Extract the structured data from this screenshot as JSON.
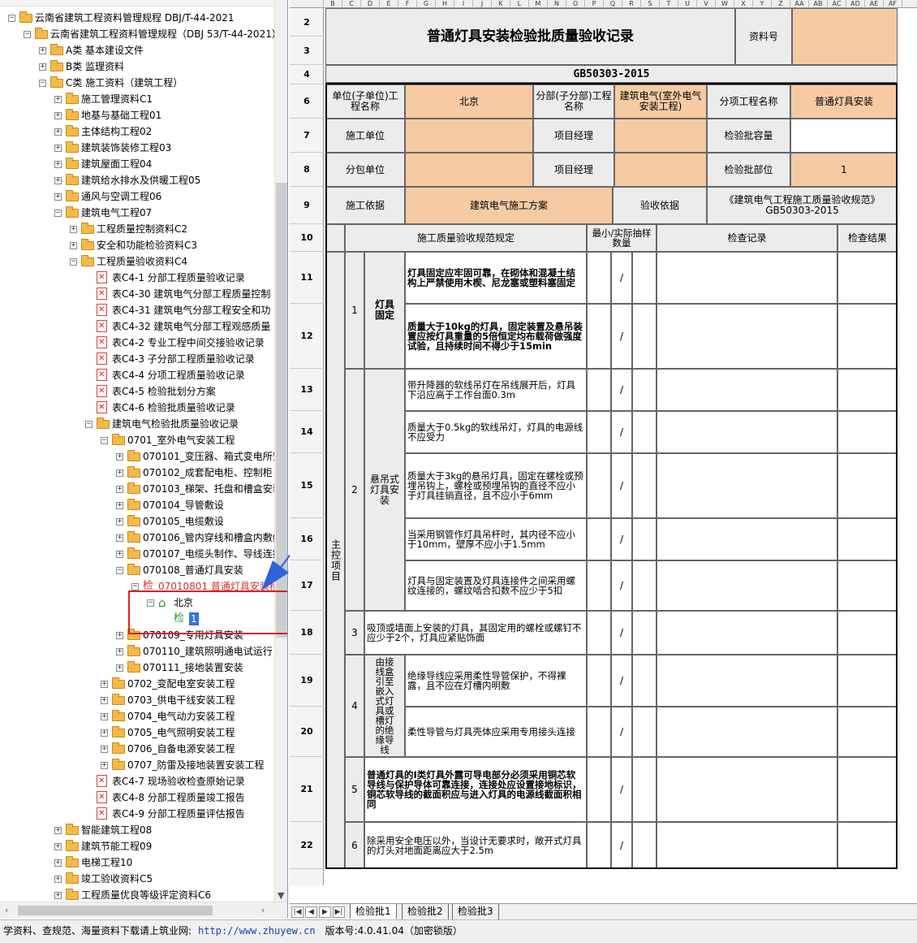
{
  "tree": {
    "items": [
      {
        "level": 0,
        "expand": "-",
        "icon": "folder",
        "label": "云南省建筑工程资料管理规程 DBJ/T-44-2021"
      },
      {
        "level": 1,
        "expand": "-",
        "icon": "folder",
        "label": "云南省建筑工程资料管理规程（DBJ 53/T-44-2021）"
      },
      {
        "level": 2,
        "expand": "+",
        "icon": "folder",
        "label": "A类 基本建设文件"
      },
      {
        "level": 2,
        "expand": "+",
        "icon": "folder",
        "label": "B类 监理资料"
      },
      {
        "level": 2,
        "expand": "-",
        "icon": "folder",
        "label": "C类 施工资料（建筑工程）"
      },
      {
        "level": 3,
        "expand": "+",
        "icon": "folder",
        "label": "施工管理资料C1"
      },
      {
        "level": 3,
        "expand": "+",
        "icon": "folder",
        "label": "地基与基础工程01"
      },
      {
        "level": 3,
        "expand": "+",
        "icon": "folder",
        "label": "主体结构工程02"
      },
      {
        "level": 3,
        "expand": "+",
        "icon": "folder",
        "label": "建筑装饰装修工程03"
      },
      {
        "level": 3,
        "expand": "+",
        "icon": "folder",
        "label": "建筑屋面工程04"
      },
      {
        "level": 3,
        "expand": "+",
        "icon": "folder",
        "label": "建筑给水排水及供暖工程05"
      },
      {
        "level": 3,
        "expand": "+",
        "icon": "folder",
        "label": "通风与空调工程06"
      },
      {
        "level": 3,
        "expand": "-",
        "icon": "folder",
        "label": "建筑电气工程07"
      },
      {
        "level": 4,
        "expand": "+",
        "icon": "folder",
        "label": "工程质量控制资料C2"
      },
      {
        "level": 4,
        "expand": "+",
        "icon": "folder",
        "label": "安全和功能检验资料C3"
      },
      {
        "level": 4,
        "expand": "-",
        "icon": "folder",
        "label": "工程质量验收资料C4"
      },
      {
        "level": 5,
        "expand": "",
        "icon": "doc",
        "label": "表C4-1 分部工程质量验收记录"
      },
      {
        "level": 5,
        "expand": "",
        "icon": "doc",
        "label": "表C4-30 建筑电气分部工程质量控制"
      },
      {
        "level": 5,
        "expand": "",
        "icon": "doc",
        "label": "表C4-31 建筑电气分部工程安全和功"
      },
      {
        "level": 5,
        "expand": "",
        "icon": "doc",
        "label": "表C4-32 建筑电气分部工程观感质量"
      },
      {
        "level": 5,
        "expand": "",
        "icon": "doc",
        "label": "表C4-2 专业工程中间交接验收记录"
      },
      {
        "level": 5,
        "expand": "",
        "icon": "doc",
        "label": "表C4-3 子分部工程质量验收记录"
      },
      {
        "level": 5,
        "expand": "",
        "icon": "doc",
        "label": "表C4-4 分项工程质量验收记录"
      },
      {
        "level": 5,
        "expand": "",
        "icon": "doc",
        "label": "表C4-5 检验批划分方案"
      },
      {
        "level": 5,
        "expand": "",
        "icon": "doc",
        "label": "表C4-6 检验批质量验收记录"
      },
      {
        "level": 5,
        "expand": "-",
        "icon": "folder",
        "label": "建筑电气检验批质量验收记录"
      },
      {
        "level": 6,
        "expand": "-",
        "icon": "folder",
        "label": "0701_室外电气安装工程"
      },
      {
        "level": 7,
        "expand": "+",
        "icon": "folder",
        "label": "070101_变压器、箱式变电所安"
      },
      {
        "level": 7,
        "expand": "+",
        "icon": "folder",
        "label": "070102_成套配电柜、控制柜"
      },
      {
        "level": 7,
        "expand": "+",
        "icon": "folder",
        "label": "070103_梯架、托盘和槽盒安装"
      },
      {
        "level": 7,
        "expand": "+",
        "icon": "folder",
        "label": "070104_导管敷设"
      },
      {
        "level": 7,
        "expand": "+",
        "icon": "folder",
        "label": "070105_电缆敷设"
      },
      {
        "level": 7,
        "expand": "+",
        "icon": "folder",
        "label": "070106_管内穿线和槽盒内敷线"
      },
      {
        "level": 7,
        "expand": "+",
        "icon": "folder",
        "label": "070107_电缆头制作、导线连接"
      },
      {
        "level": 7,
        "expand": "-",
        "icon": "folder",
        "label": "070108_普通灯具安装"
      },
      {
        "level": 8,
        "expand": "-",
        "icon": "jian-red",
        "label": "07010801 普通灯具安装检"
      },
      {
        "level": 9,
        "expand": "-",
        "icon": "house",
        "label": "北京"
      },
      {
        "level": 10,
        "expand": "",
        "icon": "jian",
        "label": "1"
      },
      {
        "level": 7,
        "expand": "+",
        "icon": "folder",
        "label": "070109_专用灯具安装"
      },
      {
        "level": 7,
        "expand": "+",
        "icon": "folder",
        "label": "070110_建筑照明通电试运行"
      },
      {
        "level": 7,
        "expand": "+",
        "icon": "folder",
        "label": "070111_接地装置安装"
      },
      {
        "level": 6,
        "expand": "+",
        "icon": "folder",
        "label": "0702_变配电室安装工程"
      },
      {
        "level": 6,
        "expand": "+",
        "icon": "folder",
        "label": "0703_供电干线安装工程"
      },
      {
        "level": 6,
        "expand": "+",
        "icon": "folder",
        "label": "0704_电气动力安装工程"
      },
      {
        "level": 6,
        "expand": "+",
        "icon": "folder",
        "label": "0705_电气照明安装工程"
      },
      {
        "level": 6,
        "expand": "+",
        "icon": "folder",
        "label": "0706_自备电源安装工程"
      },
      {
        "level": 6,
        "expand": "+",
        "icon": "folder",
        "label": "0707_防雷及接地装置安装工程"
      },
      {
        "level": 5,
        "expand": "",
        "icon": "doc",
        "label": "表C4-7 现场验收检查原始记录"
      },
      {
        "level": 5,
        "expand": "",
        "icon": "doc",
        "label": "表C4-8 分部工程质量竣工报告"
      },
      {
        "level": 5,
        "expand": "",
        "icon": "doc",
        "label": "表C4-9 分部工程质量评估报告"
      },
      {
        "level": 3,
        "expand": "+",
        "icon": "folder",
        "label": "智能建筑工程08"
      },
      {
        "level": 3,
        "expand": "+",
        "icon": "folder",
        "label": "建筑节能工程09"
      },
      {
        "level": 3,
        "expand": "+",
        "icon": "folder",
        "label": "电梯工程10"
      },
      {
        "level": 3,
        "expand": "+",
        "icon": "folder",
        "label": "竣工验收资料C5"
      },
      {
        "level": 3,
        "expand": "+",
        "icon": "folder",
        "label": "工程质量优良等级评定资料C6"
      }
    ]
  },
  "sheet": {
    "columns": [
      "B",
      "C",
      "D",
      "E",
      "F",
      "G",
      "H",
      "I",
      "J",
      "K",
      "L",
      "M",
      "N",
      "O",
      "P",
      "Q",
      "R",
      "S",
      "T",
      "U",
      "V",
      "W",
      "X",
      "Y",
      "Z",
      "AA",
      "AB",
      "AC",
      "AD",
      "AE",
      "AF"
    ],
    "rows": [
      "2",
      "3",
      "4",
      "6",
      "7",
      "8",
      "9",
      "10",
      "11",
      "12",
      "13",
      "14",
      "15",
      "16",
      "17",
      "18",
      "19",
      "20",
      "21",
      "22"
    ],
    "title": "普通灯具安装检验批质量验收记录",
    "ziliao_label": "资料号",
    "standard": "GB50303-2015",
    "unit_label": "单位(子单位)工程名称",
    "unit_value": "北京",
    "fenbu_label": "分部(子分部)工程名称",
    "fenbu_value": "建筑电气(室外电气安装工程)",
    "fenxiang_label": "分项工程名称",
    "fenxiang_value": "普通灯具安装",
    "sg_unit_label": "施工单位",
    "pm_label": "项目经理",
    "capacity_label": "检验批容量",
    "sub_unit_label": "分包单位",
    "pm2_label": "项目经理",
    "position_label": "检验批部位",
    "position_value": "1",
    "basis_label": "施工依据",
    "basis_value": "建筑电气施工方案",
    "accept_label": "验收依据",
    "accept_value": "《建筑电气工程施工质量验收规范》GB50303-2015",
    "hdr_spec": "施工质量验收规范规定",
    "hdr_sample": "最小/实际抽样数量",
    "hdr_record": "检查记录",
    "hdr_result": "检查结果",
    "main_control": "主控项目",
    "slash": "/",
    "items": {
      "n1": "1",
      "n1_name": "灯具固定",
      "i11": "灯具固定应牢固可靠，在砌体和混凝土结构上严禁使用木楔、尼龙塞或塑料塞固定",
      "i12": "质量大于10kg的灯具，固定装置及悬吊装置应按灯具重量的5倍恒定均布载荷做强度试验，且持续时间不得少于15min",
      "n2": "2",
      "n2_name": "悬吊式灯具安装",
      "i13": "带升降器的软线吊灯在吊线展开后，灯具下沿应高于工作台面0.3m",
      "i14": "质量大于0.5kg的软线吊灯，灯具的电源线不应受力",
      "i15": "质量大于3kg的悬吊灯具，固定在螺栓或预埋吊钩上，螺栓或预埋吊钩的直径不应小于灯具挂销直径，且不应小于6mm",
      "i16": "当采用钢管作灯具吊杆时，其内径不应小于10mm，壁厚不应小于1.5mm",
      "i17": "灯具与固定装置及灯具连接件之间采用螺纹连接的，螺纹啮合扣数不应少于5扣",
      "n3": "3",
      "i18": "吸顶或墙面上安装的灯具，其固定用的螺栓或螺钉不应少于2个，灯具应紧贴饰面",
      "n4": "4",
      "n4_name": "由接线盒引至嵌入式灯具或槽灯的绝缘导线",
      "i19": "绝缘导线应采用柔性导管保护，不得裸露，且不应在灯槽内明敷",
      "i20": "柔性导管与灯具壳体应采用专用接头连接",
      "n5": "5",
      "i21": "普通灯具的Ⅰ类灯具外露可导电部分必须采用铜芯软导线与保护导体可靠连接，连接处应设置接地标识，铜芯软导线的截面积应与进入灯具的电源线截面积相同",
      "n6": "6",
      "i22": "除采用安全电压以外，当设计无要求时，敞开式灯具的灯头对地面距离应大于2.5m"
    }
  },
  "tabs": [
    "检验批1",
    "检验批2",
    "检验批3"
  ],
  "status": {
    "prefix": "学资料、查规范、海量资料下载请上筑业网:",
    "url": "http://www.zhuyew.cn",
    "version": "版本号:4.0.41.04（加密锁版）"
  },
  "colors": {
    "orange": "#f6cba4",
    "gray": "#ececec",
    "highlight": "#e02020",
    "arrow": "#2f64d8"
  }
}
